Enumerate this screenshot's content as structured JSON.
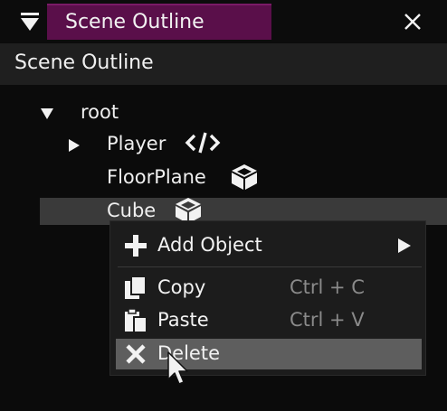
{
  "window": {
    "tab_title": "Scene Outline",
    "header_title": "Scene Outline"
  },
  "tree": {
    "root_label": "root",
    "items": [
      {
        "label": "Player",
        "icon": "code-icon",
        "expandable": true
      },
      {
        "label": "FloorPlane",
        "icon": "cube-icon"
      },
      {
        "label": "Cube",
        "icon": "cube-icon",
        "selected": true
      }
    ]
  },
  "context_menu": {
    "items": [
      {
        "label": "Add Object",
        "shortcut": "",
        "icon": "plus-icon",
        "submenu": true
      },
      {
        "label": "Copy",
        "shortcut": "Ctrl + C",
        "icon": "copy-icon"
      },
      {
        "label": "Paste",
        "shortcut": "Ctrl + V",
        "icon": "paste-icon"
      },
      {
        "label": "Delete",
        "shortcut": "",
        "icon": "x-icon",
        "hovered": true
      }
    ]
  },
  "colors": {
    "tab_active": "#5a0f4a",
    "header_band": "#1f1f1f",
    "selected_row": "#3a3a3a",
    "menu_hover": "#5e5e5e"
  }
}
